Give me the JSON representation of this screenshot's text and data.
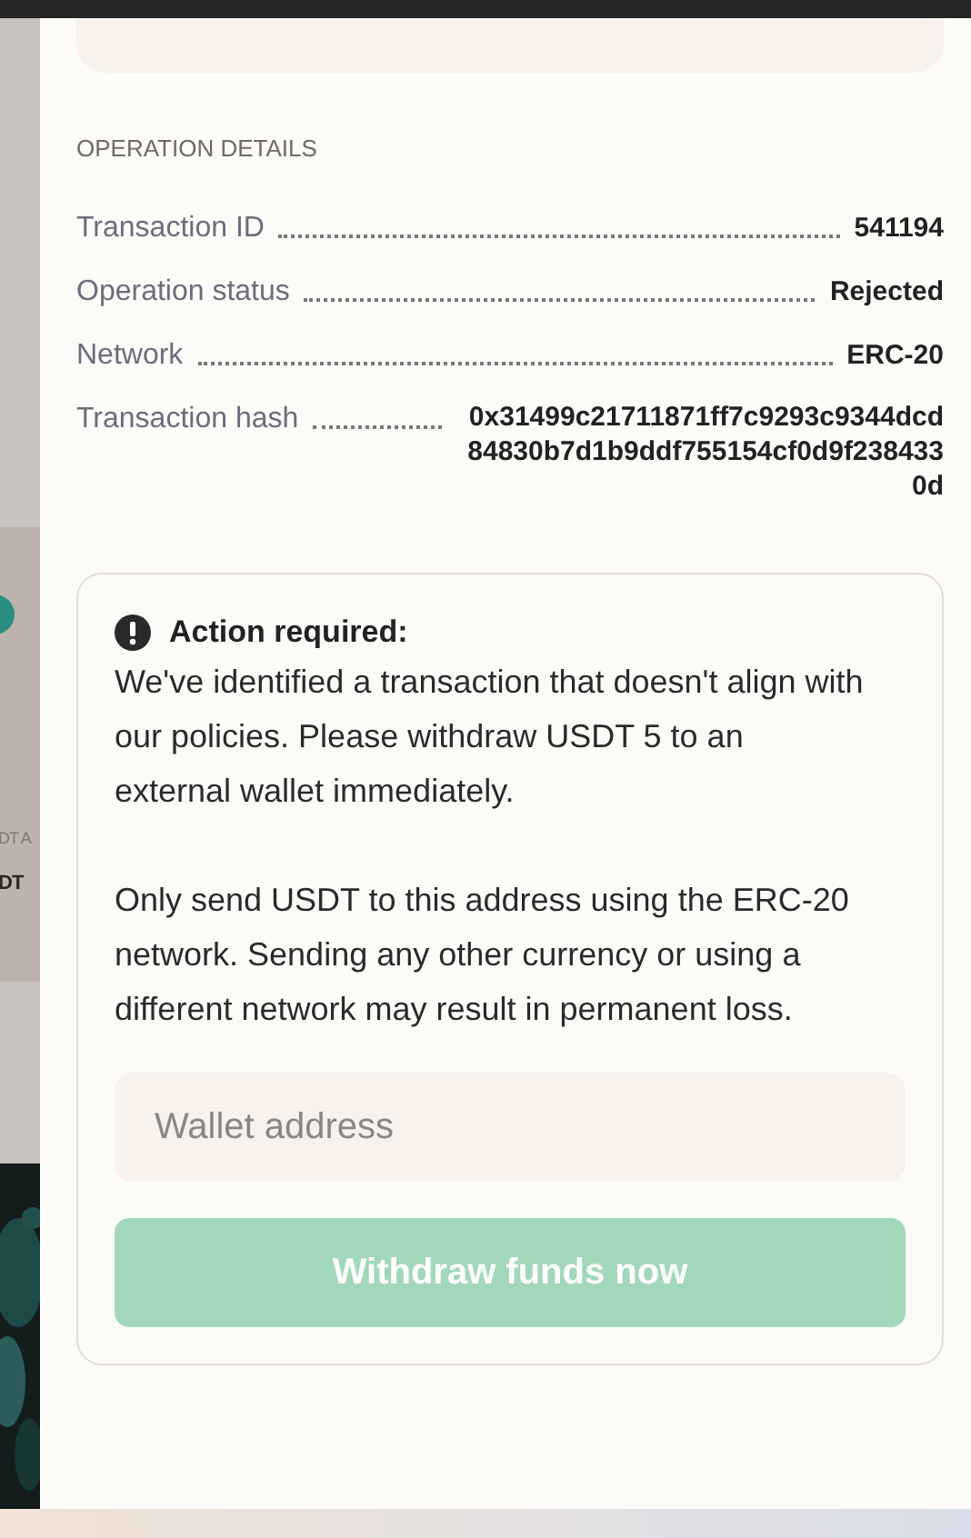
{
  "background": {
    "texts": [
      {
        "kind": "faint",
        "text": "DT A"
      },
      {
        "kind": "strong",
        "text": "DT"
      }
    ]
  },
  "details": {
    "heading": "OPERATION DETAILS",
    "rows": [
      {
        "label": "Transaction ID",
        "value": "541194"
      },
      {
        "label": "Operation status",
        "value": "Rejected"
      },
      {
        "label": "Network",
        "value": "ERC-20"
      },
      {
        "label": "Transaction hash",
        "value": "0x31499c21711871ff7c9293c9344dcd84830b7d1b9ddf755154cf0d9f2384330d"
      }
    ]
  },
  "alert": {
    "title": "Action required:",
    "paragraphs": [
      "We've identified a transaction that doesn't align with our policies. Please withdraw USDT 5 to an external wallet immediately.",
      "Only send USDT to this address using the ERC-20 network. Sending any other currency or using a different network may result in permanent loss."
    ],
    "field": {
      "placeholder": "Wallet address"
    },
    "button": {
      "label": "Withdraw funds now",
      "disabled": true
    }
  }
}
